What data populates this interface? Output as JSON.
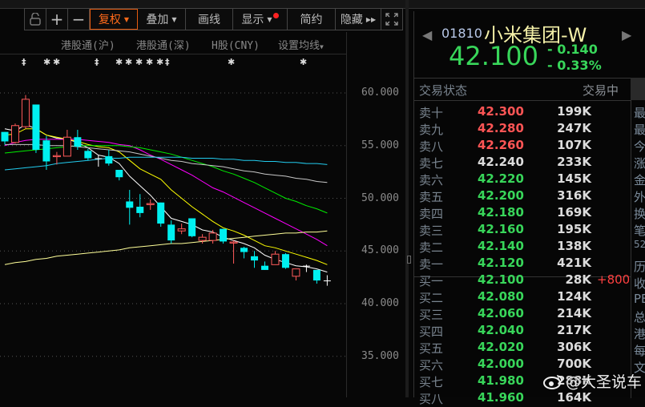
{
  "toolbar": {
    "buttons": [
      {
        "label": "+"
      },
      {
        "label": "−"
      },
      {
        "label": "复权"
      },
      {
        "label": "叠加"
      },
      {
        "label": "画线"
      },
      {
        "label": "显示"
      },
      {
        "label": "简约"
      },
      {
        "label": "隐藏"
      }
    ]
  },
  "links": [
    "港股通(沪)",
    "港股通(深)",
    "H股(CNY)",
    "设置均线"
  ],
  "markers": {
    "double": "‡",
    "star": "✱"
  },
  "axis": {
    "labels": [
      "60.000",
      "55.000",
      "50.000",
      "45.000",
      "40.000",
      "35.000"
    ]
  },
  "chart_data": {
    "type": "candlestick",
    "ylim": [
      35,
      60
    ],
    "colors": {
      "up": "#ff5a5a",
      "down": "#00f0f0",
      "flat": "#ffffff"
    },
    "candles": [
      [
        56.3,
        56.3,
        55.1,
        55.4
      ],
      [
        55.3,
        57.1,
        55.2,
        56.9
      ],
      [
        56.8,
        59.8,
        56.6,
        59.4
      ],
      [
        58.9,
        58.9,
        54.3,
        54.6
      ],
      [
        55.5,
        55.9,
        52.7,
        53.5
      ],
      [
        53.95,
        54.4,
        53.2,
        54.05
      ],
      [
        54.0,
        56.5,
        54.0,
        55.8
      ],
      [
        55.8,
        56.5,
        54.6,
        54.9
      ],
      [
        54.5,
        54.7,
        53.6,
        53.8
      ],
      [
        53.8,
        54.1,
        53.0,
        53.8
      ],
      [
        54.0,
        54.6,
        53.1,
        53.3
      ],
      [
        52.7,
        52.7,
        51.7,
        52.0
      ],
      [
        49.7,
        50.8,
        47.5,
        49.1
      ],
      [
        49.2,
        50.4,
        48.2,
        48.6
      ],
      [
        49.4,
        49.9,
        48.9,
        49.5
      ],
      [
        49.6,
        49.6,
        47.3,
        47.6
      ],
      [
        47.5,
        47.9,
        45.7,
        46.0
      ],
      [
        46.9,
        47.6,
        46.6,
        47.1
      ],
      [
        48.1,
        48.1,
        46.3,
        46.4
      ],
      [
        46.0,
        46.6,
        45.7,
        46.3
      ],
      [
        46.0,
        47.0,
        45.7,
        46.7
      ],
      [
        47.1,
        47.1,
        45.7,
        45.9
      ],
      [
        45.75,
        46.0,
        43.8,
        45.85
      ],
      [
        45.3,
        45.4,
        44.3,
        44.9
      ],
      [
        44.5,
        45.0,
        43.4,
        44.1
      ],
      [
        43.6,
        44.0,
        43.2,
        43.2
      ],
      [
        43.7,
        45.0,
        43.7,
        44.7
      ],
      [
        44.7,
        44.8,
        43.3,
        43.4
      ],
      [
        42.6,
        43.3,
        42.2,
        43.3
      ],
      [
        43.6,
        43.7,
        43.0,
        43.6
      ],
      [
        43.2,
        43.2,
        41.9,
        42.2
      ],
      [
        42.2,
        42.7,
        41.7,
        42.2
      ]
    ],
    "ma": [
      {
        "color": "#ffffff",
        "values": [
          56.6,
          56.4,
          57.0,
          56.6,
          56.0,
          55.7,
          55.6,
          55.3,
          54.8,
          54.1,
          53.9,
          53.3,
          52.1,
          51.2,
          50.3,
          49.2,
          48.1,
          47.8,
          47.5,
          47.0,
          46.8,
          46.3,
          46.0,
          45.7,
          45.3,
          44.6,
          44.2,
          43.9,
          43.6,
          43.5,
          43.3,
          43.0
        ]
      },
      {
        "color": "#ffff00",
        "values": [
          56.0,
          56.1,
          56.6,
          56.6,
          56.0,
          55.8,
          55.6,
          55.4,
          55.1,
          54.9,
          54.8,
          54.4,
          53.6,
          52.8,
          52.3,
          51.8,
          50.8,
          50.0,
          49.2,
          48.5,
          47.8,
          47.2,
          46.9,
          46.5,
          46.0,
          45.5,
          45.3,
          45.0,
          44.7,
          44.4,
          44.1,
          43.7
        ]
      },
      {
        "color": "#ff00ff",
        "values": [
          55.0,
          55.3,
          55.5,
          55.6,
          55.6,
          55.6,
          55.6,
          55.6,
          55.5,
          55.4,
          55.3,
          55.1,
          55.0,
          54.6,
          54.1,
          53.7,
          53.2,
          52.7,
          52.2,
          51.6,
          51.0,
          50.6,
          50.1,
          49.6,
          49.1,
          48.6,
          48.1,
          47.6,
          47.1,
          46.6,
          46.1,
          45.5
        ]
      },
      {
        "color": "#00ee00",
        "values": [
          54.3,
          54.4,
          54.5,
          54.6,
          54.7,
          54.8,
          54.9,
          55.0,
          55.0,
          55.0,
          55.0,
          55.0,
          54.9,
          54.8,
          54.6,
          54.4,
          54.2,
          53.9,
          53.6,
          53.3,
          53.0,
          52.6,
          52.3,
          51.9,
          51.5,
          51.0,
          50.5,
          50.0,
          49.7,
          49.3,
          49.0,
          48.6
        ]
      },
      {
        "color": "#c8c8c8",
        "values": [
          55.1,
          55.1,
          55.1,
          55.1,
          55.0,
          55.0,
          55.0,
          54.9,
          54.8,
          54.7,
          54.6,
          54.5,
          54.4,
          54.2,
          54.0,
          53.8,
          53.6,
          53.5,
          53.3,
          53.2,
          53.1,
          53.0,
          52.8,
          52.6,
          52.5,
          52.3,
          52.2,
          52.1,
          51.9,
          51.8,
          51.6,
          51.5
        ]
      },
      {
        "color": "#22ccee",
        "values": [
          52.7,
          52.8,
          52.9,
          53.0,
          53.1,
          53.3,
          53.4,
          53.5,
          53.6,
          53.7,
          53.8,
          53.8,
          53.9,
          53.9,
          53.9,
          53.9,
          53.9,
          53.9,
          53.8,
          53.8,
          53.8,
          53.7,
          53.7,
          53.6,
          53.6,
          53.5,
          53.5,
          53.4,
          53.4,
          53.3,
          53.3,
          53.2
        ]
      },
      {
        "color": "#ffff99",
        "values": [
          43.7,
          43.9,
          44.0,
          44.2,
          44.3,
          44.5,
          44.6,
          44.7,
          44.8,
          44.9,
          45.0,
          45.1,
          45.3,
          45.4,
          45.5,
          45.6,
          45.7,
          45.7,
          45.8,
          45.9,
          46.0,
          46.1,
          46.2,
          46.3,
          46.4,
          46.5,
          46.6,
          46.7,
          46.7,
          46.8,
          46.8,
          46.9
        ]
      }
    ]
  },
  "quote": {
    "code": "01810",
    "name": "小米集团-W",
    "price": "42.100",
    "change": "- 0.140",
    "change_pct": "- 0.33%",
    "status_label": "交易状态",
    "status_value": "交易中"
  },
  "asks": [
    {
      "label": "卖十",
      "price": "42.300",
      "vol": "199K",
      "color": "#ff5555"
    },
    {
      "label": "卖九",
      "price": "42.280",
      "vol": "247K",
      "color": "#ff5555"
    },
    {
      "label": "卖八",
      "price": "42.260",
      "vol": "107K",
      "color": "#ff5555"
    },
    {
      "label": "卖七",
      "price": "42.240",
      "vol": "233K",
      "color": "#dcdcdc"
    },
    {
      "label": "卖六",
      "price": "42.220",
      "vol": "145K",
      "color": "#38d65a"
    },
    {
      "label": "卖五",
      "price": "42.200",
      "vol": "316K",
      "color": "#38d65a"
    },
    {
      "label": "卖四",
      "price": "42.180",
      "vol": "169K",
      "color": "#38d65a"
    },
    {
      "label": "卖三",
      "price": "42.160",
      "vol": "195K",
      "color": "#38d65a"
    },
    {
      "label": "卖二",
      "price": "42.140",
      "vol": "138K",
      "color": "#38d65a"
    },
    {
      "label": "卖一",
      "price": "42.120",
      "vol": "421K",
      "color": "#38d65a"
    }
  ],
  "bids": [
    {
      "label": "买一",
      "price": "42.100",
      "vol": "28K",
      "extra": "+800"
    },
    {
      "label": "买二",
      "price": "42.080",
      "vol": "124K"
    },
    {
      "label": "买三",
      "price": "42.060",
      "vol": "214K"
    },
    {
      "label": "买四",
      "price": "42.040",
      "vol": "217K"
    },
    {
      "label": "买五",
      "price": "42.020",
      "vol": "306K"
    },
    {
      "label": "买六",
      "price": "42.000",
      "vol": "700K"
    },
    {
      "label": "买七",
      "price": "41.980",
      "vol": "288K"
    },
    {
      "label": "买八",
      "price": "41.960",
      "vol": "164K"
    }
  ],
  "side_labels": [
    "最",
    "最",
    "今",
    "涨",
    "金",
    "外",
    "换",
    "笔",
    "52",
    "历",
    "收",
    "PE",
    "总",
    "港",
    "每",
    "文"
  ],
  "watermark": "@大圣说车"
}
